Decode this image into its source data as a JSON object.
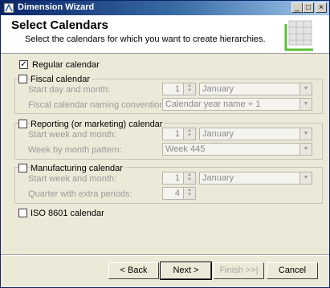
{
  "window": {
    "title": "Dimension Wizard"
  },
  "header": {
    "title": "Select Calendars",
    "subtitle": "Select the calendars for which you want to create hierarchies."
  },
  "regular": {
    "label": "Regular calendar",
    "checked": true
  },
  "fiscal": {
    "label": "Fiscal calendar",
    "start_label": "Start day and month:",
    "start_day": "1",
    "start_month": "January",
    "naming_label": "Fiscal calendar naming convention:",
    "naming_value": "Calendar year name + 1"
  },
  "reporting": {
    "label": "Reporting (or marketing) calendar",
    "start_label": "Start week and month:",
    "start_week": "1",
    "start_month": "January",
    "pattern_label": "Week by month pattern:",
    "pattern_value": "Week 445"
  },
  "manufacturing": {
    "label": "Manufacturing calendar",
    "start_label": "Start week and month:",
    "start_week": "1",
    "start_month": "January",
    "quarter_label": "Quarter with extra periods:",
    "quarter_value": "4"
  },
  "iso": {
    "label": "ISO 8601 calendar"
  },
  "buttons": {
    "back": "< Back",
    "next": "Next >",
    "finish": "Finish >>|",
    "cancel": "Cancel"
  }
}
